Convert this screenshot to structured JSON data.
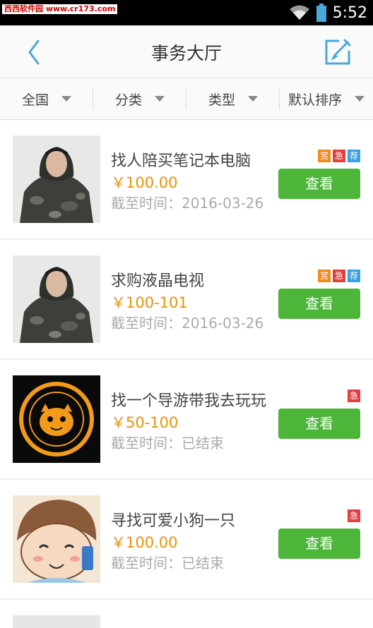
{
  "status_bar": {
    "watermark": "西西软件园 www.cr173.com",
    "time": "5:52",
    "icons": [
      "wifi-icon",
      "battery-icon"
    ]
  },
  "header": {
    "title": "事务大厅",
    "back_icon": "chevron-left-icon",
    "edit_icon": "edit-icon",
    "accent_color": "#4aa8d8"
  },
  "filters": [
    {
      "label": "全国"
    },
    {
      "label": "分类"
    },
    {
      "label": "类型"
    },
    {
      "label": "默认排序"
    }
  ],
  "colors": {
    "price": "#e8920c",
    "button": "#4cb53a",
    "badge_reward": "#f08a1c",
    "badge_urgent": "#e04040",
    "badge_recommend": "#3aa0e0"
  },
  "items": [
    {
      "title": "找人陪买笔记本电脑",
      "price": "￥100.00",
      "deadline": "截至时间：2016-03-26",
      "badges": [
        {
          "text": "赏",
          "type": "reward"
        },
        {
          "text": "急",
          "type": "urgent"
        },
        {
          "text": "荐",
          "type": "recommend"
        }
      ],
      "button": "查看",
      "image": "man-in-camo-jacket"
    },
    {
      "title": "求购液晶电视",
      "price": "￥100-101",
      "deadline": "截至时间：2016-03-26",
      "badges": [
        {
          "text": "赏",
          "type": "reward"
        },
        {
          "text": "急",
          "type": "urgent"
        },
        {
          "text": "荐",
          "type": "recommend"
        }
      ],
      "button": "查看",
      "image": "man-in-camo-jacket"
    },
    {
      "title": "找一个导游带我去玩玩",
      "price": "￥50-100",
      "deadline": "截至时间：已结束",
      "badges": [
        {
          "text": "急",
          "type": "urgent"
        }
      ],
      "button": "查看",
      "image": "orange-cartoon-logo"
    },
    {
      "title": "寻找可爱小狗一只",
      "price": "￥100.00",
      "deadline": "截至时间：已结束",
      "badges": [
        {
          "text": "急",
          "type": "urgent"
        }
      ],
      "button": "查看",
      "image": "cartoon-boy-phone"
    }
  ]
}
